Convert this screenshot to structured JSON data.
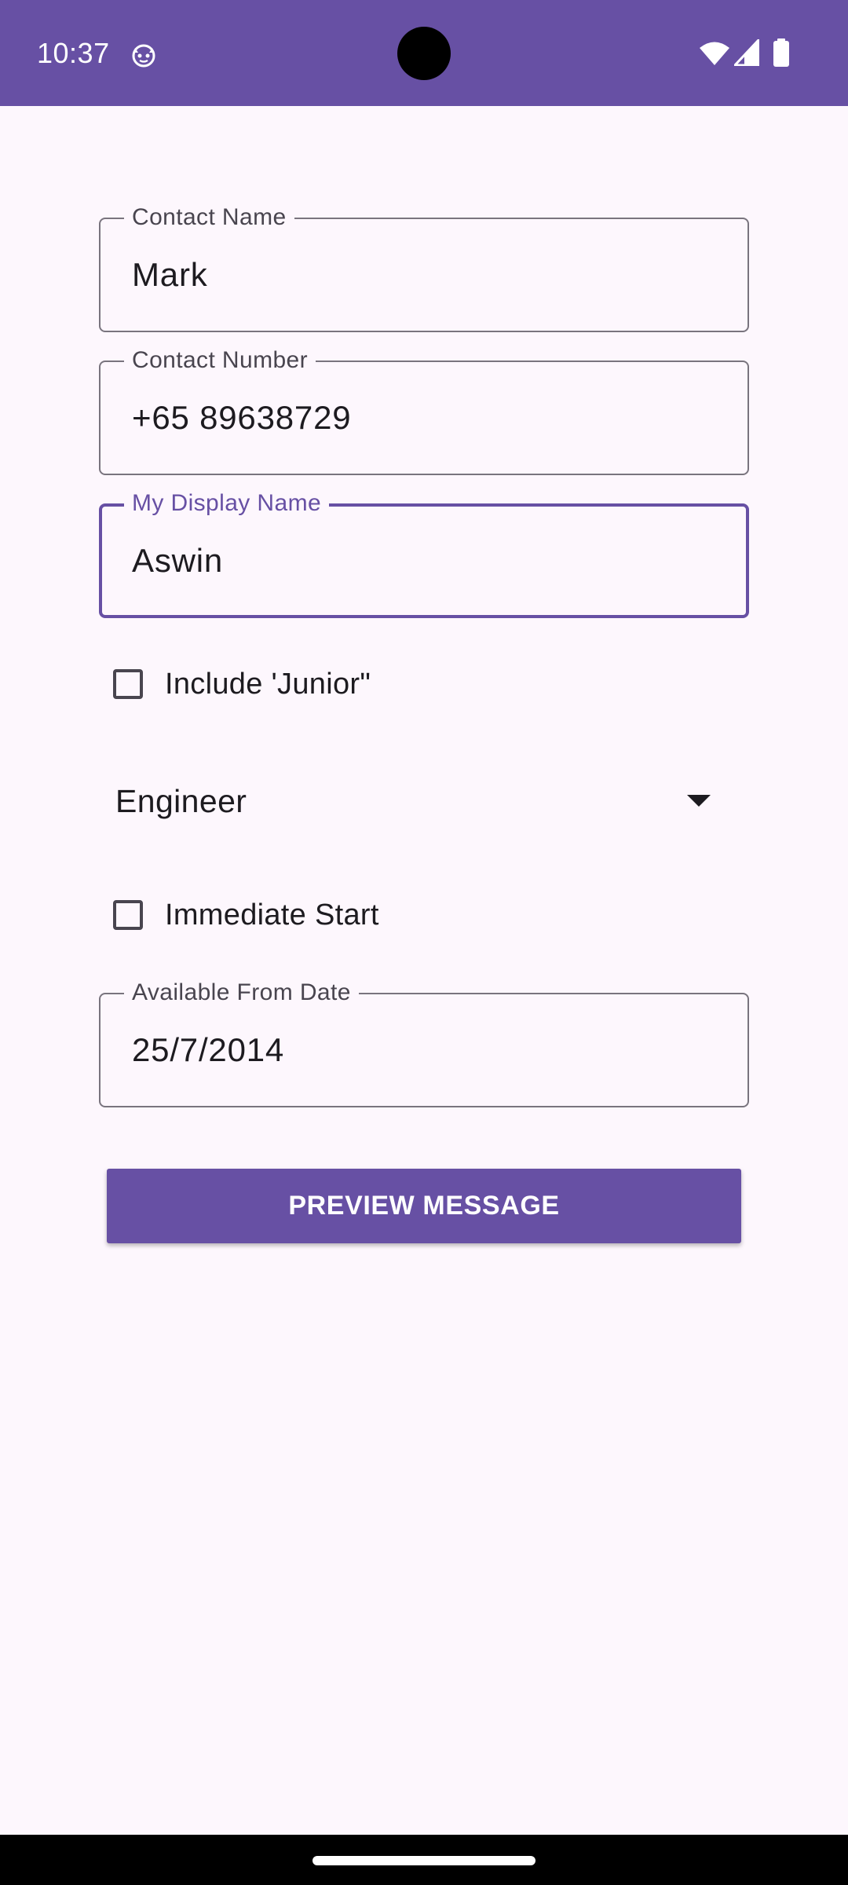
{
  "status_bar": {
    "time": "10:37",
    "icons": [
      "cat-face-icon",
      "wifi-icon",
      "signal-icon",
      "battery-icon"
    ]
  },
  "form": {
    "contact_name": {
      "label": "Contact Name",
      "value": "Mark"
    },
    "contact_number": {
      "label": "Contact Number",
      "value": "+65 89638729"
    },
    "display_name": {
      "label": "My Display Name",
      "value": "Aswin",
      "focused": true
    },
    "include_junior": {
      "label": "Include 'Junior\"",
      "checked": false
    },
    "role": {
      "selected": "Engineer"
    },
    "immediate_start": {
      "label": "Immediate Start",
      "checked": false
    },
    "available_from": {
      "label": "Available From Date",
      "value": "25/7/2014"
    },
    "preview_button": {
      "label": "PREVIEW MESSAGE"
    }
  },
  "colors": {
    "primary": "#6750A4",
    "background": "#FDF7FD",
    "outline": "#79747E",
    "text": "#1D1B20"
  }
}
